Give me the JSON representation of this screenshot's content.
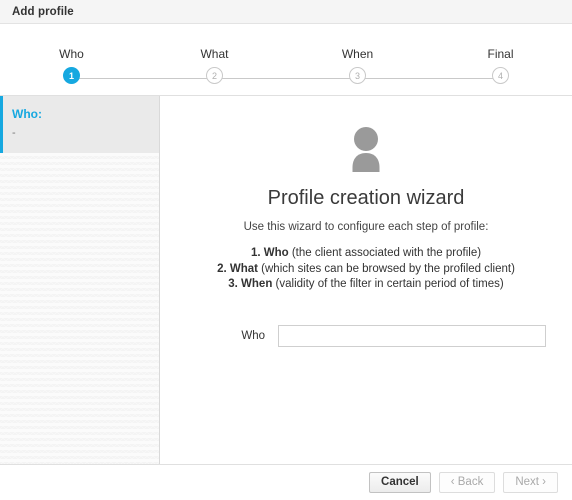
{
  "window": {
    "title": "Add profile"
  },
  "stepper": {
    "steps": [
      {
        "label": "Who",
        "number": "1",
        "state": "active"
      },
      {
        "label": "What",
        "number": "2",
        "state": "inactive"
      },
      {
        "label": "When",
        "number": "3",
        "state": "inactive"
      },
      {
        "label": "Final",
        "number": "4",
        "state": "inactive"
      }
    ],
    "active_color": "#16a8e0",
    "inactive_color": "#c9c9c9"
  },
  "sidebar": {
    "panel": {
      "title": "Who:",
      "value": "-"
    },
    "accent_color": "#16a8e0"
  },
  "content": {
    "icon": "person-icon",
    "title": "Profile creation wizard",
    "subtitle": "Use this wizard to configure each step of profile:",
    "steps": [
      {
        "prefix": "1. ",
        "name": "Who",
        "description": " (the client associated with the profile)"
      },
      {
        "prefix": "2. ",
        "name": "What",
        "description": " (which sites can be browsed by the profiled client)"
      },
      {
        "prefix": "3. ",
        "name": "When",
        "description": " (validity of the filter in certain period of times)"
      }
    ],
    "field": {
      "label": "Who",
      "value": "",
      "placeholder": ""
    }
  },
  "footer": {
    "buttons": [
      {
        "label": "Cancel",
        "style": "cancel"
      },
      {
        "label": "‹ Back",
        "style": "nav"
      },
      {
        "label": "Next ›",
        "style": "nav"
      }
    ]
  }
}
